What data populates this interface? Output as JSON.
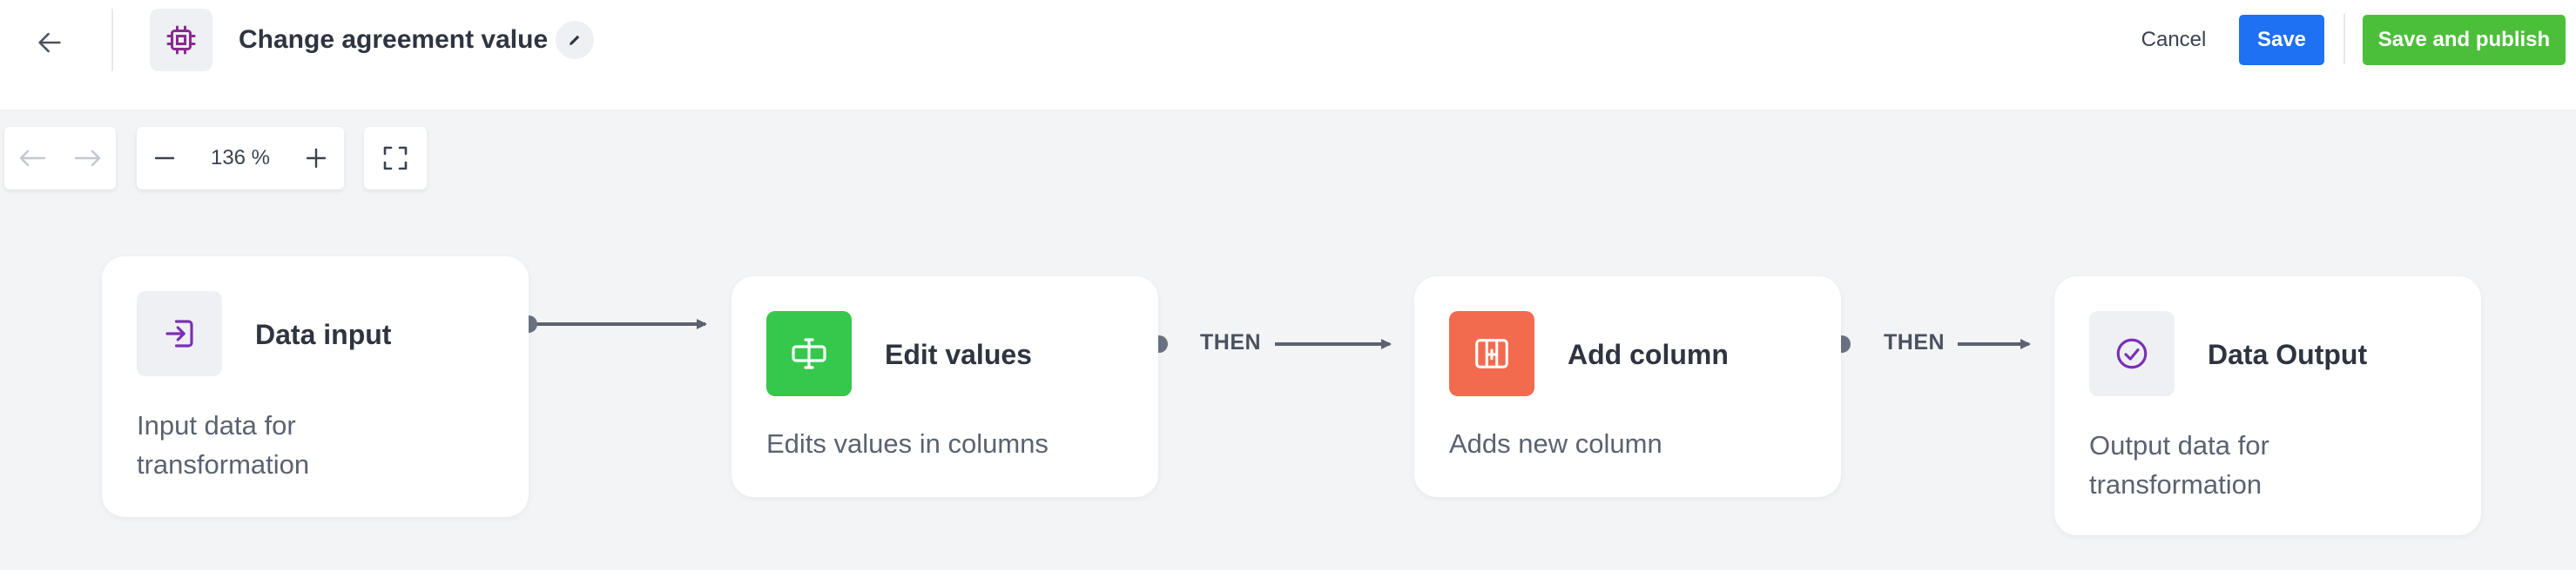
{
  "header": {
    "back_icon": "arrow-left-icon",
    "app_icon": "cpu-chip-icon",
    "title": "Change agreement value",
    "edit_icon": "pencil-icon",
    "cancel_label": "Cancel",
    "save_label": "Save",
    "publish_label": "Save and publish",
    "colors": {
      "save": "#1d71f2",
      "publish": "#4cbf3a"
    }
  },
  "toolbar": {
    "undo_icon": "undo-icon",
    "redo_icon": "redo-icon",
    "zoom_out_icon": "minus-icon",
    "zoom_level": "136 %",
    "zoom_in_icon": "plus-icon",
    "fullscreen_icon": "fullscreen-icon"
  },
  "flow": {
    "nodes": [
      {
        "title": "Data input",
        "description": "Input data for transformation",
        "icon": "import-icon",
        "icon_color": "#eef0f3"
      },
      {
        "title": "Edit values",
        "description": "Edits values in columns",
        "icon": "text-cursor-icon",
        "icon_color": "#36c84c"
      },
      {
        "title": "Add column",
        "description": "Adds new column",
        "icon": "add-column-icon",
        "icon_color": "#f26b4f"
      },
      {
        "title": "Data Output",
        "description": "Output data for transformation",
        "icon": "check-circle-icon",
        "icon_color": "#eef0f3"
      }
    ],
    "connectors": [
      {
        "label": ""
      },
      {
        "label": "THEN"
      },
      {
        "label": "THEN"
      }
    ]
  }
}
